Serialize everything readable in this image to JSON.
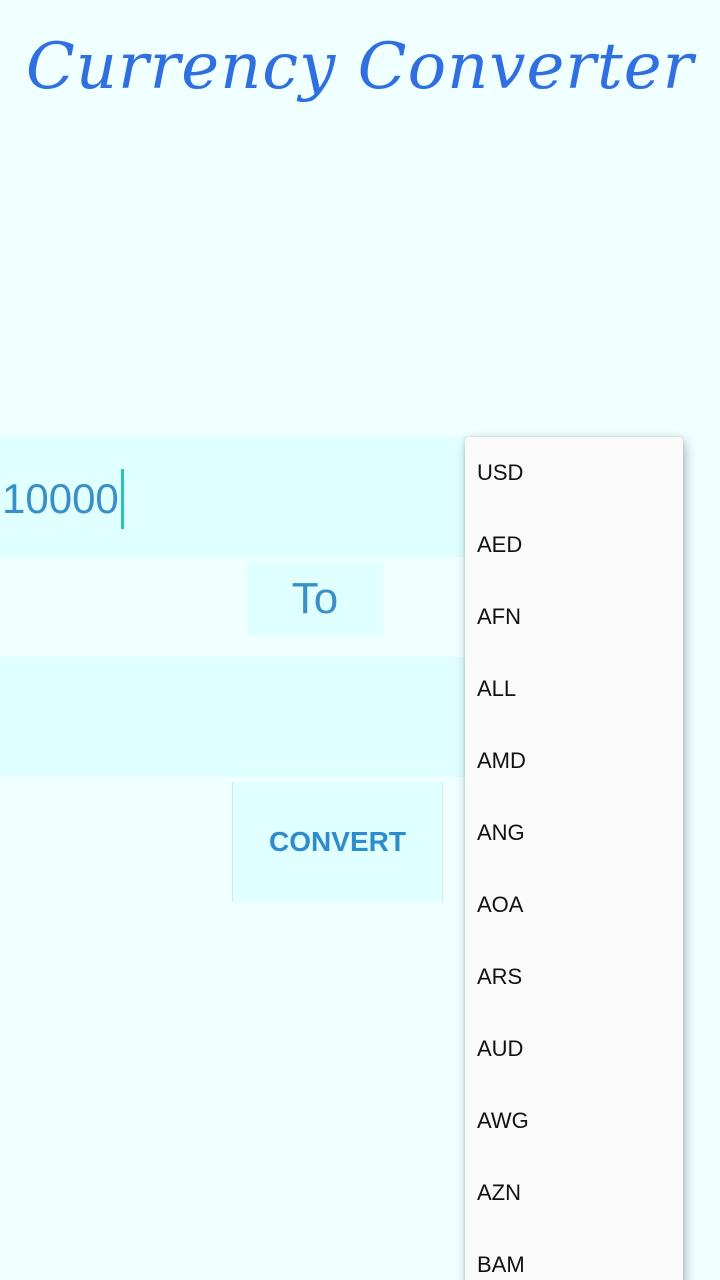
{
  "app": {
    "title": "Currency Converter"
  },
  "amount_input": {
    "value": "10000"
  },
  "to_label": "To",
  "result_field": {
    "value": ""
  },
  "convert_button": {
    "label": "CONVERT"
  },
  "currency_dropdown": {
    "options": [
      "USD",
      "AED",
      "AFN",
      "ALL",
      "AMD",
      "ANG",
      "AOA",
      "ARS",
      "AUD",
      "AWG",
      "AZN",
      "BAM"
    ]
  },
  "colors": {
    "background": "#f0ffff",
    "field_background": "#e0ffff",
    "title": "#2f6fe0",
    "accent_text": "#3a8fc8",
    "cursor": "#26c6b6"
  }
}
